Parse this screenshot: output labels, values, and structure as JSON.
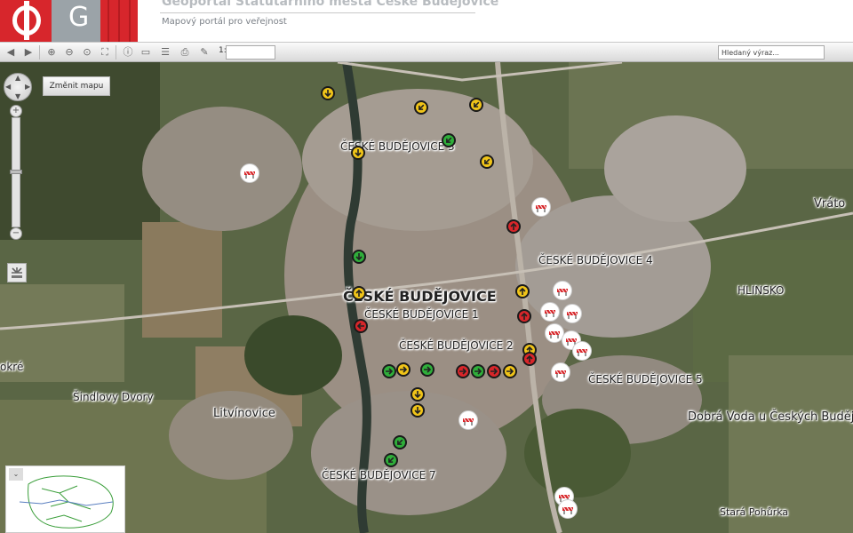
{
  "header": {
    "title": "Geoportál Statutárního města České Budějovice",
    "subtitle": "Mapový portál pro veřejnost",
    "logo_letter": "G"
  },
  "toolbar": {
    "scale_prefix": "1:",
    "scale_value": "",
    "search_placeholder": "Hledaný výraz..."
  },
  "map": {
    "change_map_button": "Změnit mapu",
    "labels": [
      {
        "text": "ČESKÉ BUDĚJOVICE 3"
      },
      {
        "text": "ČESKÉ BUDĚJOVICE 4"
      },
      {
        "text": "HLINSKO"
      },
      {
        "text": "ČESKÉ BUDĚJOVICE"
      },
      {
        "text": "ČESKÉ BUDĚJOVICE 1"
      },
      {
        "text": "ČESKÉ BUDĚJOVICE 2"
      },
      {
        "text": "ČESKÉ BUDĚJOVICE 5"
      },
      {
        "text": "ČESKÉ BUDĚJOVICE 7"
      },
      {
        "text": "Šindlovy Dvory"
      },
      {
        "text": "Litvínovice"
      },
      {
        "text": "Dobrá Voda u Českých Budějovic"
      },
      {
        "text": "Stará Pohůrka"
      },
      {
        "text": "Vráto"
      },
      {
        "text": "okré"
      }
    ]
  },
  "colors": {
    "brand_red": "#d7262c",
    "brand_grey": "#9ba3a8",
    "marker_yellow": "#f0c419",
    "marker_green": "#2fae3a",
    "marker_red": "#d8262a",
    "roadwork": "#ffffff"
  }
}
